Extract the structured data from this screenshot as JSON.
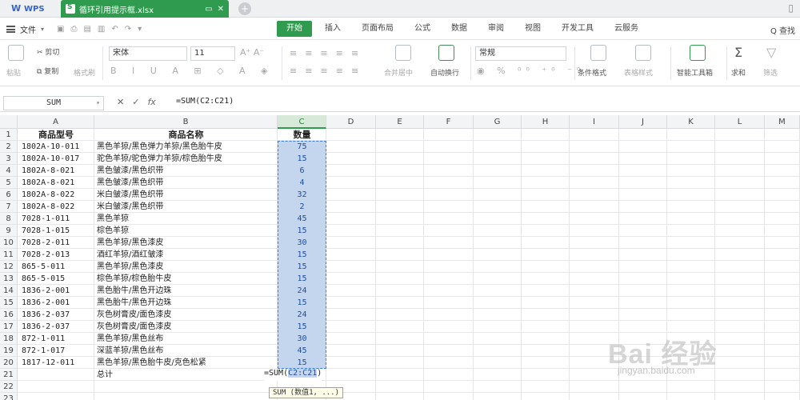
{
  "titlebar": {
    "app_name": "WPS",
    "file_tab": "循环引用提示框.xlsx"
  },
  "menubar": {
    "file_menu": "文件",
    "tabs": [
      "开始",
      "插入",
      "页面布局",
      "公式",
      "数据",
      "审阅",
      "视图",
      "开发工具",
      "云服务"
    ],
    "active_tab": "开始",
    "search": "Q 查找"
  },
  "ribbon": {
    "cut": "剪切",
    "copy": "复制",
    "paste": "粘贴",
    "format_painter": "格式刷",
    "font_name": "宋体",
    "font_size": "11",
    "merge": "合并居中",
    "wrap": "自动换行",
    "number_format": "常规",
    "conditional_format": "条件格式",
    "table_style": "表格样式",
    "smart_toolbox": "智能工具箱",
    "sum": "求和",
    "filter": "筛选"
  },
  "formulabar": {
    "name_box": "SUM",
    "fx": "fx",
    "formula": "=SUM(C2:C21)"
  },
  "columns": [
    "A",
    "B",
    "C",
    "D",
    "E",
    "F",
    "G",
    "H",
    "I",
    "J",
    "K",
    "L",
    "M"
  ],
  "rows": [
    "1",
    "2",
    "3",
    "4",
    "5",
    "6",
    "7",
    "8",
    "9",
    "10",
    "11",
    "12",
    "13",
    "14",
    "15",
    "16",
    "17",
    "18",
    "19",
    "20",
    "21",
    "22",
    "23"
  ],
  "table": {
    "headers": [
      "商品型号",
      "商品名称",
      "数量"
    ],
    "data": [
      [
        "1802A-10-011",
        "黑色羊猄/黑色弹力羊猄/黑色胎牛皮",
        "75"
      ],
      [
        "1802A-10-017",
        "驼色羊猄/驼色弹力羊猄/棕色胎牛皮",
        "15"
      ],
      [
        "1802A-8-021",
        "黑色皱漆/黑色织带",
        "6"
      ],
      [
        "1802A-8-021",
        "黑色皱漆/黑色织带",
        "4"
      ],
      [
        "1802A-8-022",
        "米白皱漆/黑色织带",
        "32"
      ],
      [
        "1802A-8-022",
        "米白皱漆/黑色织带",
        "2"
      ],
      [
        "7028-1-011",
        "黑色羊猄",
        "45"
      ],
      [
        "7028-1-015",
        "棕色羊猄",
        "15"
      ],
      [
        "7028-2-011",
        "黑色羊猄/黑色漆皮",
        "30"
      ],
      [
        "7028-2-013",
        "酒红羊猄/酒红皱漆",
        "15"
      ],
      [
        "865-5-011",
        "黑色羊猄/黑色漆皮",
        "15"
      ],
      [
        "865-5-015",
        "棕色羊猄/棕色胎牛皮",
        "15"
      ],
      [
        "1836-2-001",
        "黑色胎牛/黑色开边珠",
        "24"
      ],
      [
        "1836-2-001",
        "黑色胎牛/黑色开边珠",
        "15"
      ],
      [
        "1836-2-037",
        "灰色树膏皮/面色漆皮",
        "24"
      ],
      [
        "1836-2-037",
        "灰色树膏皮/面色漆皮",
        "15"
      ],
      [
        "872-1-011",
        "黑色羊猄/黑色丝布",
        "30"
      ],
      [
        "872-1-017",
        "深蓝羊猄/黑色丝布",
        "45"
      ],
      [
        "1817-12-011",
        "黑色羊猄/黑色胎牛皮/克色松紧",
        "15"
      ]
    ],
    "total_label": "总计",
    "editing_prefix": "=SUM(",
    "editing_ref": "C2:C21",
    "editing_suffix": ")",
    "tooltip": "SUM (数值1, ...)"
  },
  "watermark": {
    "text": "Bai 经验",
    "sub": "jingyan.baidu.com"
  },
  "colors": {
    "accent": "#2e9b4e",
    "range_fill": "#c4d5ee",
    "range_border": "#3d7bd0"
  }
}
